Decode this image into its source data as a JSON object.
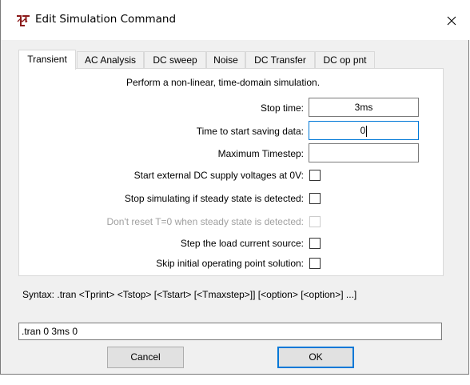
{
  "window": {
    "title": "Edit Simulation Command",
    "close_glyph": "×",
    "app_icon": "ltspice-icon",
    "accent": "#0078d7"
  },
  "tabs": [
    {
      "label": "Transient",
      "active": true
    },
    {
      "label": "AC Analysis",
      "active": false
    },
    {
      "label": "DC sweep",
      "active": false
    },
    {
      "label": "Noise",
      "active": false
    },
    {
      "label": "DC Transfer",
      "active": false
    },
    {
      "label": "DC op pnt",
      "active": false
    }
  ],
  "transient": {
    "description": "Perform a non-linear, time-domain simulation.",
    "fields": [
      {
        "label": "Stop time:",
        "value": "3ms"
      },
      {
        "label": "Time to start saving data:",
        "value": "0"
      },
      {
        "label": "Maximum Timestep:",
        "value": ""
      }
    ],
    "checkboxes": [
      {
        "label": "Start external DC supply voltages at 0V:",
        "checked": false,
        "enabled": true
      },
      {
        "label": "Stop simulating if steady state is detected:",
        "checked": false,
        "enabled": true
      },
      {
        "label": "Don't reset T=0 when steady state is detected:",
        "checked": false,
        "enabled": false
      },
      {
        "label": "Step the load current source:",
        "checked": false,
        "enabled": true
      },
      {
        "label": "Skip initial operating point solution:",
        "checked": false,
        "enabled": true
      }
    ]
  },
  "syntax": "Syntax:  .tran <Tprint> <Tstop> [<Tstart> [<Tmaxstep>]] [<option> [<option>] ...]",
  "command_line": ".tran 0 3ms 0",
  "buttons": {
    "cancel": "Cancel",
    "ok": "OK"
  }
}
